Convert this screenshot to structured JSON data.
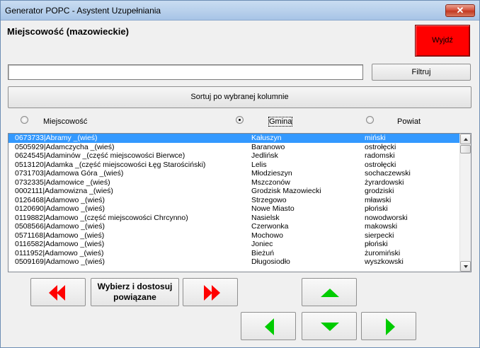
{
  "window": {
    "title": "Generator POPC - Asystent Uzupełniania",
    "close_glyph": "✕"
  },
  "header": {
    "heading": "Miejscowość (mazowieckie)",
    "exit_label": "Wyjdź"
  },
  "filter": {
    "input_value": "",
    "button_label": "Filtruj"
  },
  "sort": {
    "button_label": "Sortuj po wybranej kolumnie"
  },
  "columns": [
    {
      "label": "Miejscowość",
      "checked": false
    },
    {
      "label": "Gmina",
      "checked": true
    },
    {
      "label": "Powiat",
      "checked": false
    }
  ],
  "rows": [
    {
      "miejscowosc": "0673733|Abramy _(wieś)",
      "gmina": "Kałuszyn",
      "powiat": "miński",
      "selected": true
    },
    {
      "miejscowosc": "0505929|Adamczycha _(wieś)",
      "gmina": "Baranowo",
      "powiat": "ostrołęcki",
      "selected": false
    },
    {
      "miejscowosc": "0624545|Adaminów _(część miejscowości Bierwce)",
      "gmina": "Jedlińsk",
      "powiat": "radomski",
      "selected": false
    },
    {
      "miejscowosc": "0513120|Adamka _(część miejscowości Łęg Starościński)",
      "gmina": "Lelis",
      "powiat": "ostrołęcki",
      "selected": false
    },
    {
      "miejscowosc": "0731703|Adamowa Góra _(wieś)",
      "gmina": "Młodzieszyn",
      "powiat": "sochaczewski",
      "selected": false
    },
    {
      "miejscowosc": "0732335|Adamowice _(wieś)",
      "gmina": "Mszczonów",
      "powiat": "żyrardowski",
      "selected": false
    },
    {
      "miejscowosc": "0002111|Adamowizna _(wieś)",
      "gmina": "Grodzisk Mazowiecki",
      "powiat": "grodziski",
      "selected": false
    },
    {
      "miejscowosc": "0126468|Adamowo _(wieś)",
      "gmina": "Strzegowo",
      "powiat": "mławski",
      "selected": false
    },
    {
      "miejscowosc": "0120690|Adamowo _(wieś)",
      "gmina": "Nowe Miasto",
      "powiat": "płoński",
      "selected": false
    },
    {
      "miejscowosc": "0119882|Adamowo _(część miejscowości Chrcynno)",
      "gmina": "Nasielsk",
      "powiat": "nowodworski",
      "selected": false
    },
    {
      "miejscowosc": "0508566|Adamowo _(wieś)",
      "gmina": "Czerwonka",
      "powiat": "makowski",
      "selected": false
    },
    {
      "miejscowosc": "0571168|Adamowo _(wieś)",
      "gmina": "Mochowo",
      "powiat": "sierpecki",
      "selected": false
    },
    {
      "miejscowosc": "0116582|Adamowo _(wieś)",
      "gmina": "Joniec",
      "powiat": "płoński",
      "selected": false
    },
    {
      "miejscowosc": "0111952|Adamowo _(wieś)",
      "gmina": "Bieżuń",
      "powiat": "żuromiński",
      "selected": false
    },
    {
      "miejscowosc": "0509169|Adamowo _(wieś)",
      "gmina": "Długosiodło",
      "powiat": "wyszkowski",
      "selected": false
    }
  ],
  "actions": {
    "adjust_line1": "Wybierz i dostosuj",
    "adjust_line2": "powiązane"
  },
  "colors": {
    "exit_bg": "#ff0000",
    "selection": "#3399ff",
    "arrow_red": "#ff0000",
    "arrow_green": "#00cc00"
  }
}
